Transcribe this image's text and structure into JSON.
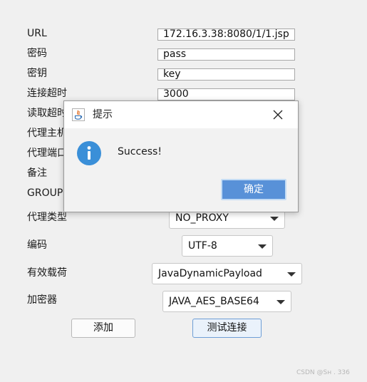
{
  "form": {
    "labels": {
      "url": "URL",
      "password": "密码",
      "secret_key": "密钥",
      "connect_timeout": "连接超时",
      "read_timeout": "读取超时",
      "proxy_host": "代理主机",
      "proxy_port": "代理端口",
      "remark": "备注",
      "group": "GROUP",
      "proxy_type": "代理类型",
      "encoding": "编码",
      "payload": "有效载荷",
      "cryptor": "加密器"
    },
    "values": {
      "url": "172.16.3.38:8080/1/1.jsp",
      "password": "pass",
      "secret_key": "key",
      "connect_timeout": "3000"
    },
    "selects": {
      "proxy_type": "NO_PROXY",
      "encoding": "UTF-8",
      "payload": "JavaDynamicPayload",
      "cryptor": "JAVA_AES_BASE64"
    },
    "buttons": {
      "add": "添加",
      "test_connection": "测试连接"
    }
  },
  "dialog": {
    "title": "提示",
    "message": "Success!",
    "ok_label": "确定",
    "icon": "info-icon",
    "close_icon": "close-icon"
  },
  "watermark": "CSDN @Sн    . 336",
  "colors": {
    "dialog_button": "#5891d8",
    "info_icon": "#3a8fd8",
    "background": "#f0f0f0"
  }
}
